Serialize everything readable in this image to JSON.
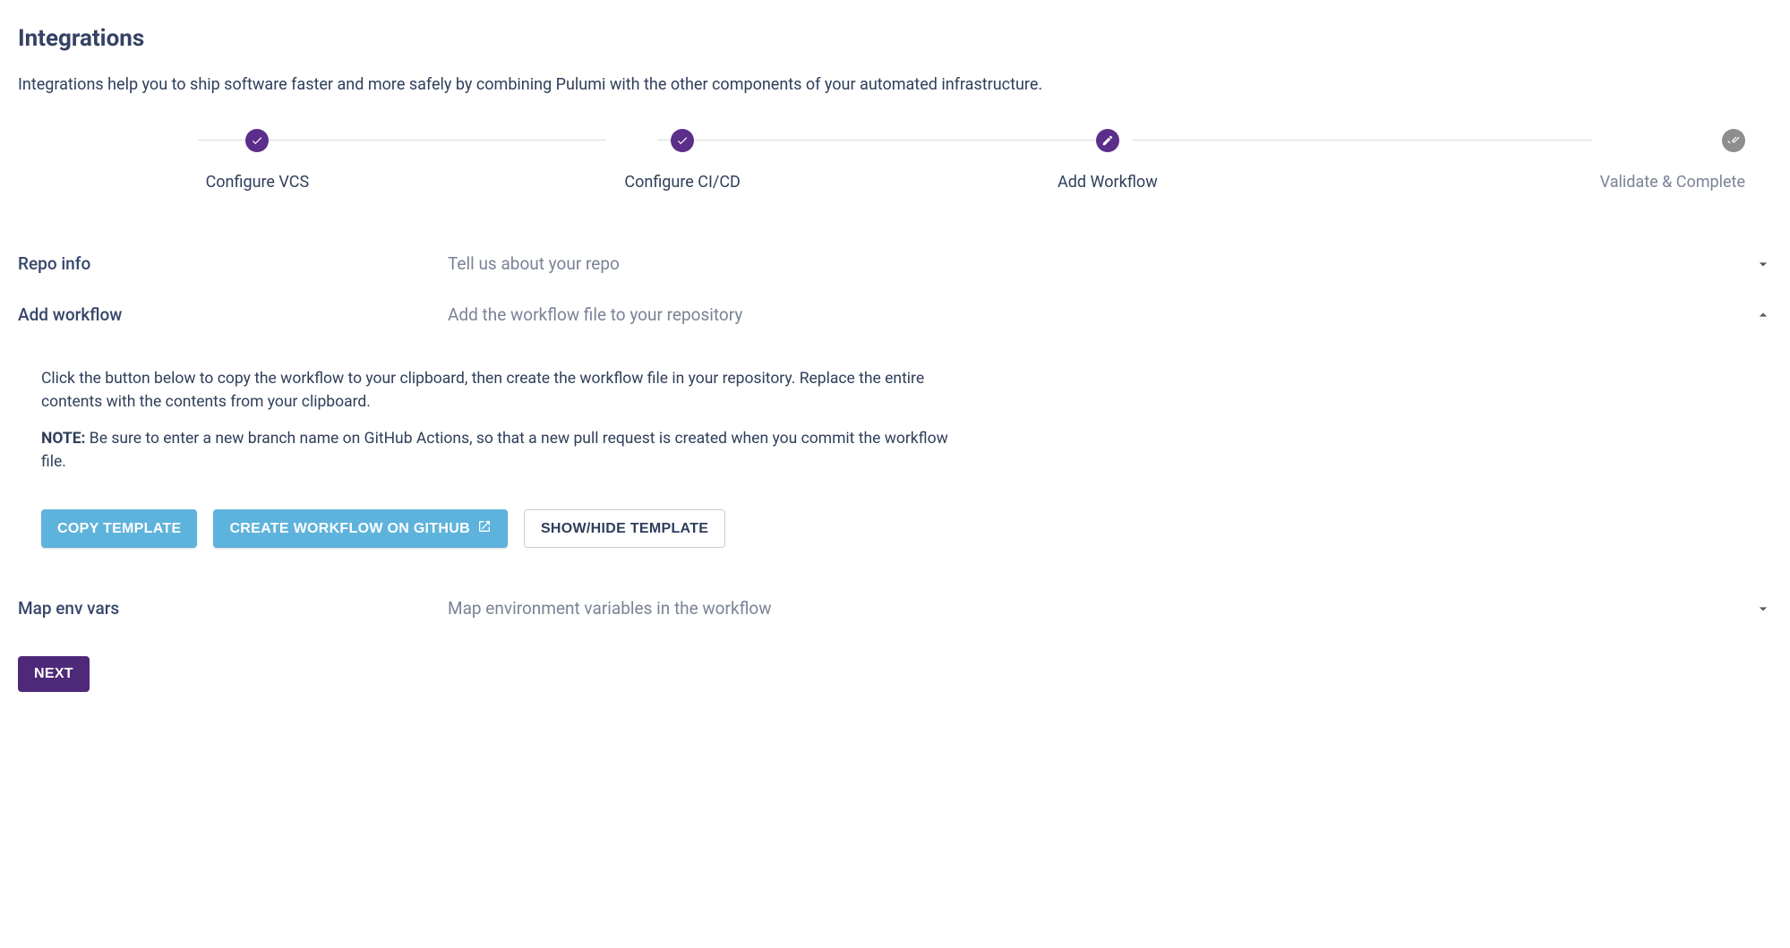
{
  "header": {
    "title": "Integrations",
    "intro": "Integrations help you to ship software faster and more safely by combining Pulumi with the other components of your automated infrastructure."
  },
  "stepper": {
    "steps": [
      {
        "label": "Configure VCS",
        "state": "done",
        "icon": "check"
      },
      {
        "label": "Configure CI/CD",
        "state": "done",
        "icon": "check"
      },
      {
        "label": "Add Workflow",
        "state": "current",
        "icon": "pencil"
      },
      {
        "label": "Validate & Complete",
        "state": "future",
        "icon": "double-check"
      }
    ]
  },
  "sections": {
    "repo_info": {
      "title": "Repo info",
      "desc": "Tell us about your repo",
      "expanded": false
    },
    "add_workflow": {
      "title": "Add workflow",
      "desc": "Add the workflow file to your repository",
      "expanded": true,
      "body_p1": "Click the button below to copy the workflow to your clipboard, then create the workflow file in your repository. Replace the entire contents with the contents from your clipboard.",
      "note_label": "NOTE:",
      "body_note": " Be sure to enter a new branch name on GitHub Actions, so that a new pull request is created when you commit the workflow file.",
      "buttons": {
        "copy_template": "COPY TEMPLATE",
        "create_workflow": "CREATE WORKFLOW ON GITHUB",
        "toggle_template": "SHOW/HIDE TEMPLATE"
      }
    },
    "map_env": {
      "title": "Map env vars",
      "desc": "Map environment variables in the workflow",
      "expanded": false
    }
  },
  "footer": {
    "next": "NEXT"
  }
}
